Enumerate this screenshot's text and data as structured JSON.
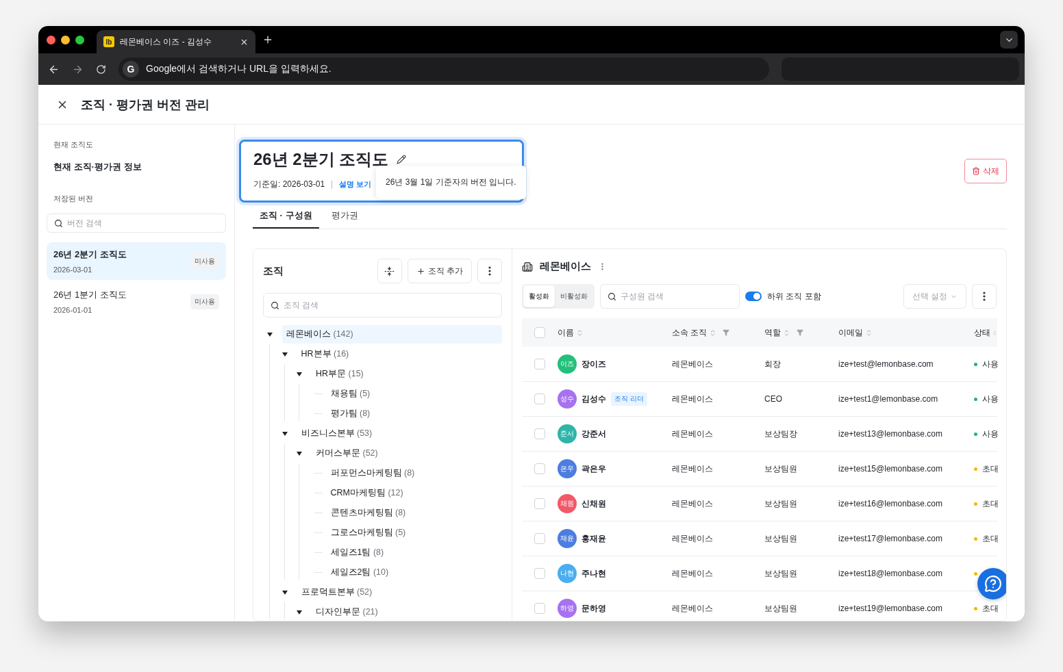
{
  "browser": {
    "favicon": "lb",
    "tab_title": "레몬베이스 이즈 - 김성수",
    "address": "Google에서 검색하거나 URL을 입력하세요.",
    "engine_badge": "G"
  },
  "header": {
    "title": "조직 · 평가권 버전 관리"
  },
  "sidebar": {
    "current_label": "현재 조직도",
    "current_item": "현재 조직·평가권 정보",
    "saved_label": "저장된 버전",
    "search": {
      "placeholder": "버전 검색"
    },
    "versions": [
      {
        "name": "26년 2분기 조직도",
        "date": "2026-03-01",
        "badge": "미사용",
        "selected": true
      },
      {
        "name": "26년 1분기 조직도",
        "date": "2026-01-01",
        "badge": "미사용",
        "selected": false
      }
    ]
  },
  "version": {
    "title": "26년 2분기 조직도",
    "date_label": "기준일: 2026-03-01",
    "link": "설명 보기",
    "tooltip": "26년 3월 1일 기준자의 버전 입니다.",
    "delete": "삭제"
  },
  "tabs": [
    {
      "label": "조직 · 구성원",
      "selected": true
    },
    {
      "label": "평가권",
      "selected": false
    }
  ],
  "org_panel": {
    "title": "조직",
    "add_button": "조직 추가",
    "search": {
      "placeholder": "조직 검색"
    },
    "tree": [
      {
        "name": "레몬베이스",
        "count": "(142)",
        "selected": true,
        "expanded": true,
        "children": [
          {
            "name": "HR본부",
            "count": "(16)",
            "selected": false,
            "expanded": true,
            "children": [
              {
                "name": "HR부문",
                "count": "(15)",
                "selected": false,
                "expanded": true,
                "children": [
                  {
                    "name": "채용팀",
                    "count": "(5)",
                    "selected": false
                  },
                  {
                    "name": "평가팀",
                    "count": "(8)",
                    "selected": false
                  }
                ]
              }
            ]
          },
          {
            "name": "비즈니스본부",
            "count": "(53)",
            "selected": false,
            "expanded": true,
            "children": [
              {
                "name": "커머스부문",
                "count": "(52)",
                "selected": false,
                "expanded": true,
                "children": [
                  {
                    "name": "퍼포먼스마케팅팀",
                    "count": "(8)",
                    "selected": false
                  },
                  {
                    "name": "CRM마케팅팀",
                    "count": "(12)",
                    "selected": false
                  },
                  {
                    "name": "콘텐츠마케팅팀",
                    "count": "(8)",
                    "selected": false
                  },
                  {
                    "name": "그로스마케팅팀",
                    "count": "(5)",
                    "selected": false
                  },
                  {
                    "name": "세일즈1팀",
                    "count": "(8)",
                    "selected": false
                  },
                  {
                    "name": "세일즈2팀",
                    "count": "(10)",
                    "selected": false
                  }
                ]
              }
            ]
          },
          {
            "name": "프로덕트본부",
            "count": "(52)",
            "selected": false,
            "expanded": true,
            "children": [
              {
                "name": "디자인부문",
                "count": "(21)",
                "selected": false,
                "expanded": true
              }
            ]
          }
        ]
      }
    ]
  },
  "members": {
    "title": "레몬베이스",
    "filters": [
      {
        "label": "활성화",
        "selected": true
      },
      {
        "label": "비활성화",
        "selected": false
      }
    ],
    "search": {
      "placeholder": "구성원 검색"
    },
    "include_sub": {
      "label": "하위 조직 포함",
      "on": true
    },
    "select": {
      "label": "선택 설정",
      "disabled": true
    },
    "all_checked": false,
    "columns": [
      {
        "label": "이름",
        "filter": false
      },
      {
        "label": "소속 조직",
        "filter": true
      },
      {
        "label": "역할",
        "filter": true
      },
      {
        "label": "이메일",
        "filter": false
      },
      {
        "label": "상태",
        "filter": false
      }
    ],
    "rows": [
      {
        "checked": false,
        "avatar": {
          "initials": "이즈",
          "color": "#22c07a"
        },
        "name": "장이즈",
        "org": "레몬베이스",
        "role": "회장",
        "email": "ize+test@lemonbase.com",
        "status": {
          "label": "사용",
          "color": "#22b573"
        }
      },
      {
        "checked": false,
        "avatar": {
          "initials": "성수",
          "color": "#a772f0"
        },
        "name": "김성수",
        "tag": "조직 리더",
        "org": "레몬베이스",
        "role": "CEO",
        "email": "ize+test1@lemonbase.com",
        "status": {
          "label": "사용",
          "color": "#22b573"
        }
      },
      {
        "checked": false,
        "avatar": {
          "initials": "준서",
          "color": "#2db5a8"
        },
        "name": "강준서",
        "org": "레몬베이스",
        "role": "보상팀장",
        "email": "ize+test13@lemonbase.com",
        "status": {
          "label": "사용",
          "color": "#22b573"
        }
      },
      {
        "checked": false,
        "avatar": {
          "initials": "은우",
          "color": "#4d7de0"
        },
        "name": "곽은우",
        "org": "레몬베이스",
        "role": "보상팀원",
        "email": "ize+test15@lemonbase.com",
        "status": {
          "label": "초대",
          "color": "#f5b800"
        }
      },
      {
        "checked": false,
        "avatar": {
          "initials": "채원",
          "color": "#f05a68"
        },
        "name": "신채원",
        "org": "레몬베이스",
        "role": "보상팀원",
        "email": "ize+test16@lemonbase.com",
        "status": {
          "label": "초대",
          "color": "#f5b800"
        }
      },
      {
        "checked": false,
        "avatar": {
          "initials": "재윤",
          "color": "#4d7de0"
        },
        "name": "홍재윤",
        "org": "레몬베이스",
        "role": "보상팀원",
        "email": "ize+test17@lemonbase.com",
        "status": {
          "label": "초대",
          "color": "#f5b800"
        }
      },
      {
        "checked": false,
        "avatar": {
          "initials": "나현",
          "color": "#4aaef0"
        },
        "name": "주나현",
        "org": "레몬베이스",
        "role": "보상팀원",
        "email": "ize+test18@lemonbase.com",
        "status": {
          "color": "#f5b800"
        }
      },
      {
        "checked": false,
        "avatar": {
          "initials": "하영",
          "color": "#a772f0"
        },
        "name": "문하영",
        "org": "레몬베이스",
        "role": "보상팀원",
        "email": "ize+test19@lemonbase.com",
        "status": {
          "label": "초대",
          "color": "#f5b800"
        }
      }
    ]
  }
}
